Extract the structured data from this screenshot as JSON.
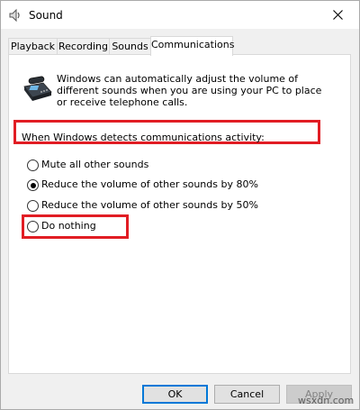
{
  "window": {
    "title": "Sound"
  },
  "tabs": [
    {
      "label": "Playback"
    },
    {
      "label": "Recording"
    },
    {
      "label": "Sounds"
    },
    {
      "label": "Communications"
    }
  ],
  "active_tab": "Communications",
  "communications": {
    "description": "Windows can automatically adjust the volume of different sounds when you are using your PC to place or receive telephone calls.",
    "group_label": "When Windows detects communications activity:",
    "options": [
      {
        "label": "Mute all other sounds",
        "checked": false
      },
      {
        "label": "Reduce the volume of other sounds by 80%",
        "checked": true
      },
      {
        "label": "Reduce the volume of other sounds by 50%",
        "checked": false
      },
      {
        "label": "Do nothing",
        "checked": false
      }
    ]
  },
  "buttons": {
    "ok": "OK",
    "cancel": "Cancel",
    "apply": "Apply"
  },
  "watermark": "wsxdn.com",
  "colors": {
    "highlight_box": "#e11d24",
    "default_button_border": "#0078d7"
  }
}
